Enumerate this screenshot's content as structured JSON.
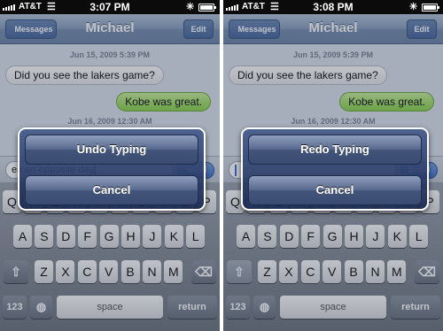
{
  "screens": [
    {
      "status": {
        "carrier": "AT&T",
        "time": "3:07 PM"
      },
      "nav": {
        "back_label": "Messages",
        "title": "Michael",
        "edit_label": "Edit"
      },
      "messages": {
        "timestamp1": "Jun 15, 2009 5:39 PM",
        "incoming1": "Did you see the lakers game?",
        "outgoing1": "Kobe was great.",
        "timestamp2": "Jun 16, 2009 12:30 AM"
      },
      "composer": {
        "text": "ea on opposite day",
        "send_label": "Send"
      },
      "alert": {
        "action_label": "Undo Typing",
        "cancel_label": "Cancel"
      },
      "shift_active": false
    },
    {
      "status": {
        "carrier": "AT&T",
        "time": "3:08 PM"
      },
      "nav": {
        "back_label": "Messages",
        "title": "Michael",
        "edit_label": "Edit"
      },
      "messages": {
        "timestamp1": "Jun 15, 2009 5:39 PM",
        "incoming1": "Did you see the lakers game?",
        "outgoing1": "Kobe was great.",
        "timestamp2": "Jun 16, 2009 12:30 AM"
      },
      "composer": {
        "text": "",
        "send_label": "Send"
      },
      "alert": {
        "action_label": "Redo Typing",
        "cancel_label": "Cancel"
      },
      "shift_active": true
    }
  ],
  "keyboard": {
    "row1": [
      "Q",
      "W",
      "E",
      "R",
      "T",
      "Y",
      "U",
      "I",
      "O",
      "P"
    ],
    "row2": [
      "A",
      "S",
      "D",
      "F",
      "G",
      "H",
      "J",
      "K",
      "L"
    ],
    "row3": [
      "Z",
      "X",
      "C",
      "V",
      "B",
      "N",
      "M"
    ],
    "numbers_label": "123",
    "space_label": "space",
    "return_label": "return"
  },
  "icons": {
    "wifi": "wifi-icon",
    "bluetooth": "bluetooth-icon",
    "battery": "battery-icon",
    "shift": "shift-arrow-icon",
    "delete": "delete-key-icon",
    "globe": "globe-icon"
  },
  "colors": {
    "outgoing_bubble": "#8ad24a",
    "nav_bar": "#7a90b0",
    "alert_background": "#2a3c66"
  }
}
